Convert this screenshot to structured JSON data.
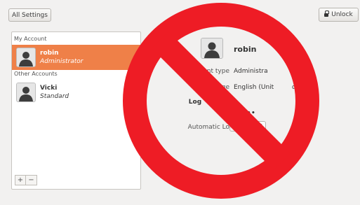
{
  "header": {
    "all_settings_label": "All Settings",
    "unlock_label": "Unlock"
  },
  "sidebar": {
    "my_account_label": "My Account",
    "other_accounts_label": "Other Accounts",
    "accounts": [
      {
        "name": "robin",
        "role": "Administrator",
        "selected": true
      },
      {
        "name": "Vicki",
        "role": "Standard",
        "selected": false
      }
    ],
    "add_label": "+",
    "remove_label": "−"
  },
  "detail": {
    "user_name": "robin",
    "account_type_label": "Account type",
    "account_type_value": "Administra",
    "language_label": "nguage",
    "language_value": "English (Unit         dom)",
    "login_options_label": "Log      ions",
    "password_label": "Pa",
    "password_value": "•••••",
    "auto_login_label": "Automatic Lo",
    "auto_login_state": "OFF"
  },
  "colors": {
    "selection": "#ef8048",
    "forbidden_sign": "#ee1c25"
  },
  "icons": {
    "lock": "lock-icon",
    "avatar": "user-silhouette-icon",
    "overlay": "no-entry-sign-icon"
  }
}
